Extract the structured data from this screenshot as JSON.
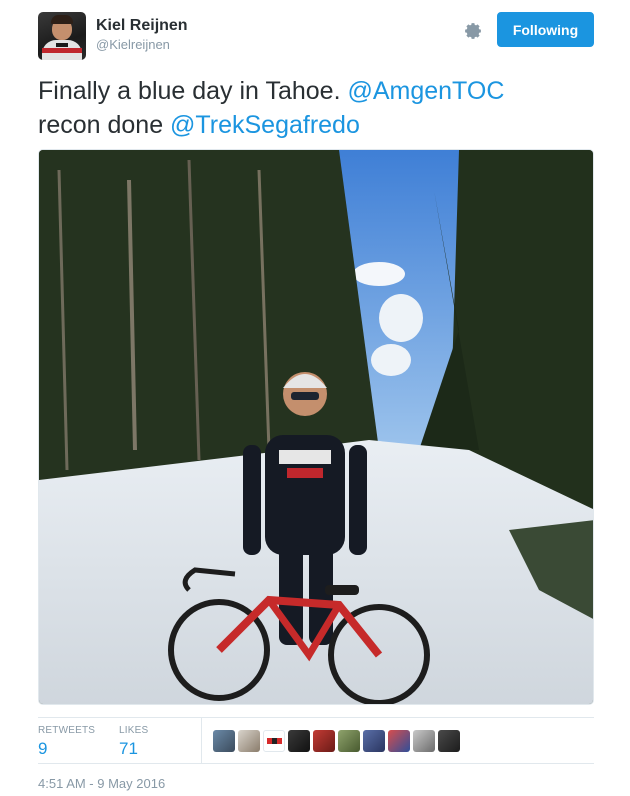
{
  "author": {
    "display_name": "Kiel Reijnen",
    "handle": "@Kielreijnen"
  },
  "actions": {
    "follow_label": "Following",
    "settings_icon": "gear-icon"
  },
  "tweet": {
    "text_before": "Finally a blue day in Tahoe. ",
    "mention_1": "@AmgenTOC",
    "text_middle": " recon done ",
    "mention_2": "@TrekSegafredo"
  },
  "stats": {
    "retweets_label": "RETWEETS",
    "retweets_value": "9",
    "likes_label": "LIKES",
    "likes_value": "71"
  },
  "timestamp": "4:51 AM - 9 May 2016",
  "colors": {
    "accent": "#1b95e0",
    "text": "#292f33",
    "muted": "#8899a6",
    "border": "#e1e8ed"
  }
}
